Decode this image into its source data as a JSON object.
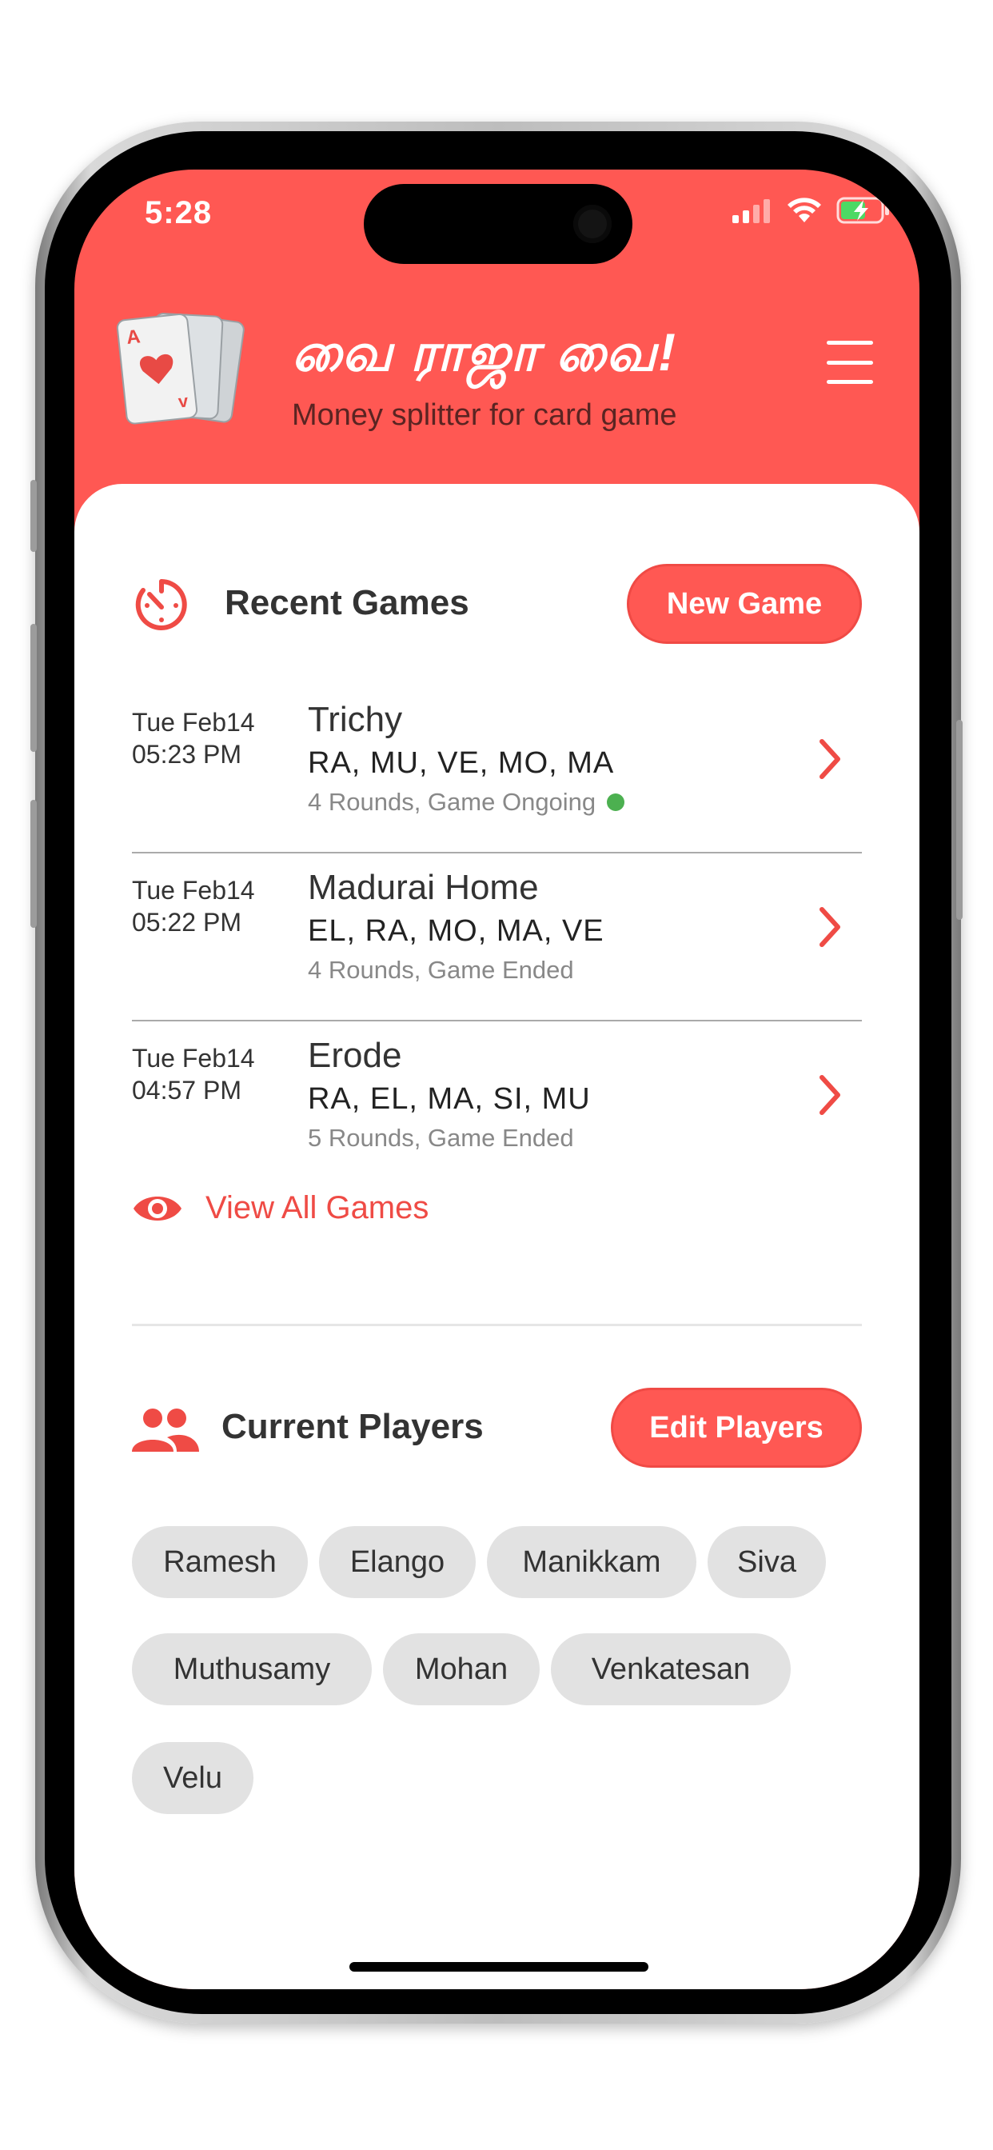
{
  "status_bar": {
    "time": "5:28"
  },
  "header": {
    "title": "வை ராஜா வை!",
    "subtitle": "Money splitter for card game"
  },
  "recent_games": {
    "title": "Recent Games",
    "new_game_label": "New Game",
    "games": [
      {
        "date": "Tue Feb14",
        "time": "05:23 PM",
        "name": "Trichy",
        "players": "RA, MU, VE, MO, MA",
        "status": "4 Rounds, Game Ongoing",
        "ongoing": true
      },
      {
        "date": "Tue Feb14",
        "time": "05:22 PM",
        "name": "Madurai Home",
        "players": "EL, RA, MO, MA, VE",
        "status": "4 Rounds, Game Ended",
        "ongoing": false
      },
      {
        "date": "Tue Feb14",
        "time": "04:57 PM",
        "name": "Erode",
        "players": "RA, EL, MA, SI, MU",
        "status": "5 Rounds, Game Ended",
        "ongoing": false
      }
    ],
    "view_all_label": "View All Games"
  },
  "current_players": {
    "title": "Current Players",
    "edit_label": "Edit Players",
    "players": [
      "Ramesh",
      "Elango",
      "Manikkam",
      "Siva",
      "Muthusamy",
      "Mohan",
      "Venkatesan",
      "Velu"
    ]
  },
  "colors": {
    "accent": "#ff5853",
    "accent_text": "#ef4b45",
    "chip_bg": "#e2e2e2",
    "ongoing_dot": "#4cb050"
  },
  "icons": {
    "logo": "playing-cards-icon",
    "menu": "hamburger-menu-icon",
    "recent": "timer-icon",
    "players": "group-icon",
    "view_all": "eye-icon",
    "row_action": "chevron-right-icon"
  }
}
